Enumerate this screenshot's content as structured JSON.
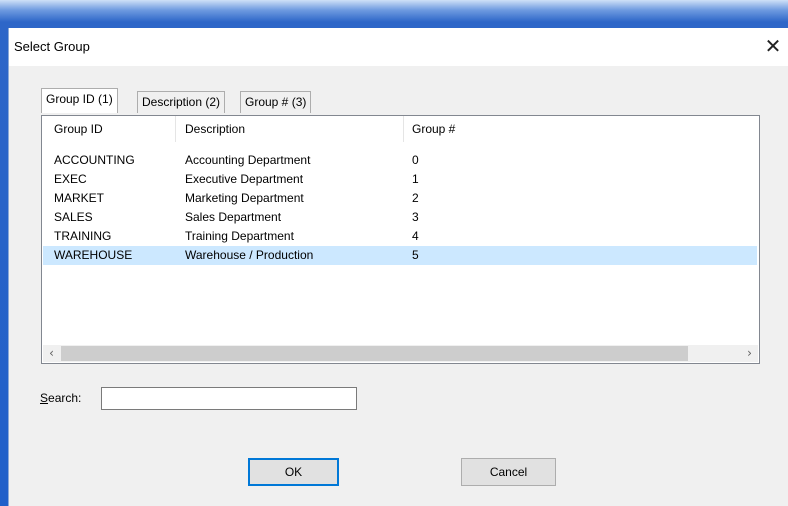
{
  "dialog": {
    "title": "Select Group",
    "close_glyph": "✕",
    "close_icon": "close-icon"
  },
  "tabs": [
    {
      "label": "Group ID (1)",
      "active": true
    },
    {
      "label": "Description (2)",
      "active": false
    },
    {
      "label": "Group # (3)",
      "active": false
    }
  ],
  "table": {
    "columns": [
      "Group ID",
      "Description",
      "Group #"
    ],
    "rows": [
      {
        "id": "ACCOUNTING",
        "description": "Accounting Department",
        "number": "0",
        "selected": false
      },
      {
        "id": "EXEC",
        "description": "Executive Department",
        "number": "1",
        "selected": false
      },
      {
        "id": "MARKET",
        "description": "Marketing Department",
        "number": "2",
        "selected": false
      },
      {
        "id": "SALES",
        "description": "Sales Department",
        "number": "3",
        "selected": false
      },
      {
        "id": "TRAINING",
        "description": "Training Department",
        "number": "4",
        "selected": false
      },
      {
        "id": "WAREHOUSE",
        "description": "Warehouse / Production",
        "number": "5",
        "selected": true
      }
    ],
    "scrollbar": {
      "left_glyph": "‹",
      "right_glyph": "›"
    }
  },
  "search": {
    "label_prefix": "S",
    "label_rest": "earch:",
    "value": ""
  },
  "buttons": {
    "ok": "OK",
    "cancel": "Cancel"
  },
  "colors": {
    "selection": "#cce8ff",
    "frame_blue": "#1f5fc9",
    "default_button_border": "#0078d7"
  }
}
